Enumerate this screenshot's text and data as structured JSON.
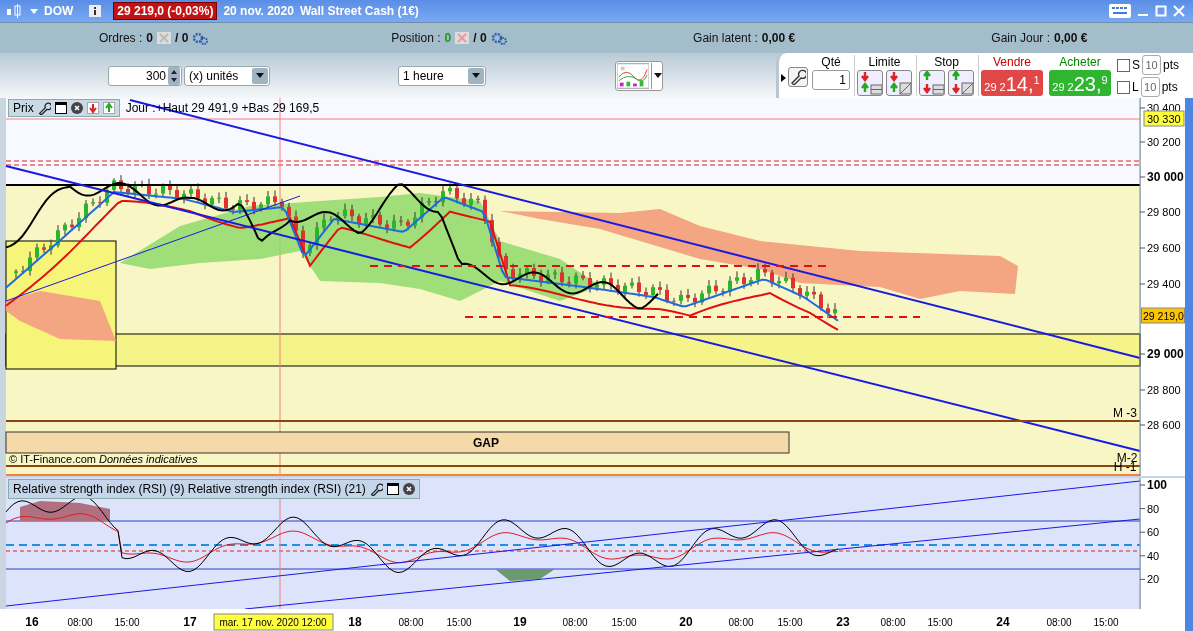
{
  "title_bar": {
    "symbol": "DOW",
    "price_change": "29 219,0 (-0,03%)",
    "date": "20 nov. 2020",
    "instrument": "Wall Street Cash (1€)"
  },
  "info_bar": [
    {
      "kind": "count",
      "label": "Ordres :",
      "value": "0",
      "positive": false,
      "total": "/ 0"
    },
    {
      "kind": "count",
      "label": "Position :",
      "value": "0",
      "positive": true,
      "total": "/ 0"
    },
    {
      "kind": "amount",
      "label": "Gain latent :",
      "value": "0,00 €"
    },
    {
      "kind": "amount",
      "label": "Gain Jour :",
      "value": "0,00 €"
    }
  ],
  "toolbar": {
    "quantity": "300",
    "unit": "(x) unités",
    "period": "1 heure"
  },
  "order_panel": {
    "qty_label": "Qté",
    "qty": "1",
    "limit_label": "Limite",
    "stop_label": "Stop",
    "sell": {
      "label": "Vendre",
      "prefix": "29 2",
      "main": "14,",
      "sup": "1"
    },
    "buy": {
      "label": "Acheter",
      "prefix": "29 2",
      "main": "23,",
      "sup": "9"
    },
    "offsets": [
      {
        "letter": "S",
        "value": "10",
        "unit": "pts",
        "checked": false
      },
      {
        "letter": "L",
        "value": "10",
        "unit": "pts",
        "checked": false
      }
    ]
  },
  "price_chart": {
    "title": "Prix",
    "info": "Jour :+Haut 29 491,9 +Bas 29 169,5",
    "y_labels": [
      {
        "text": "30 400",
        "major": false
      },
      {
        "text": "30 200",
        "major": false
      },
      {
        "text": "30 000",
        "major": true
      },
      {
        "text": "29 800",
        "major": false
      },
      {
        "text": "29 600",
        "major": false
      },
      {
        "text": "29 400",
        "major": false
      },
      {
        "text": "29 000",
        "major": true
      },
      {
        "text": "28 800",
        "major": false
      },
      {
        "text": "28 600",
        "major": false
      }
    ],
    "marker": "30 330",
    "last_price": "29 219,0",
    "levels": [
      "M -3",
      "M-2",
      "H -1"
    ],
    "gap_label": "GAP",
    "credit": "© IT-Finance.com",
    "credit_note": "Données indicatives"
  },
  "rsi_chart": {
    "title": "Relative strength index (RSI) (9) Relative strength index (RSI) (21)",
    "y_labels": [
      "100",
      "80",
      "60",
      "40",
      "20"
    ]
  },
  "time_axis": {
    "cursor_label": "mar. 17 nov. 2020 12:00",
    "labels": [
      {
        "text": "16",
        "major": true
      },
      {
        "text": "08:00",
        "major": false
      },
      {
        "text": "15:00",
        "major": false
      },
      {
        "text": "17",
        "major": true
      },
      {
        "text": "18",
        "major": true
      },
      {
        "text": "08:00",
        "major": false
      },
      {
        "text": "15:00",
        "major": false
      },
      {
        "text": "19",
        "major": true
      },
      {
        "text": "08:00",
        "major": false
      },
      {
        "text": "15:00",
        "major": false
      },
      {
        "text": "20",
        "major": true
      },
      {
        "text": "08:00",
        "major": false
      },
      {
        "text": "15:00",
        "major": false
      },
      {
        "text": "23",
        "major": true
      },
      {
        "text": "08:00",
        "major": false
      },
      {
        "text": "15:00",
        "major": false
      },
      {
        "text": "24",
        "major": true
      },
      {
        "text": "08:00",
        "major": false
      },
      {
        "text": "15:00",
        "major": false
      }
    ]
  }
}
